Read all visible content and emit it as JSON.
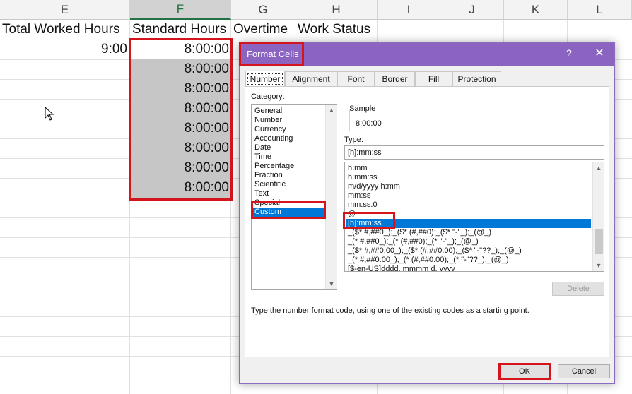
{
  "sheet": {
    "columns": [
      "E",
      "F",
      "G",
      "H",
      "I",
      "J",
      "K",
      "L"
    ],
    "headers": {
      "e": "Total Worked Hours",
      "f": "Standard Hours",
      "g": "Overtime",
      "h": "Work Status"
    },
    "total_worked_e": "9:00",
    "standard_hours": [
      "8:00:00",
      "8:00:00",
      "8:00:00",
      "8:00:00",
      "8:00:00",
      "8:00:00",
      "8:00:00",
      "8:00:00"
    ]
  },
  "dialog": {
    "title": "Format Cells",
    "help": "?",
    "close": "✕",
    "tabs": [
      "Number",
      "Alignment",
      "Font",
      "Border",
      "Fill",
      "Protection"
    ],
    "category_label": "Category:",
    "categories": [
      "General",
      "Number",
      "Currency",
      "Accounting",
      "Date",
      "Time",
      "Percentage",
      "Fraction",
      "Scientific",
      "Text",
      "Special",
      "Custom"
    ],
    "selected_category": "Custom",
    "sample_label": "Sample",
    "sample_value": "8:00:00",
    "type_label": "Type:",
    "type_value": "[h]:mm:ss",
    "type_list": [
      "h:mm",
      "h:mm:ss",
      "m/d/yyyy h:mm",
      "mm:ss",
      "mm:ss.0",
      "@",
      "[h]:mm:ss",
      "_($* #,##0_);_($* (#,##0);_($* \"-\"_);_(@_)",
      "_(* #,##0_);_(* (#,##0);_(* \"-\"_);_(@_)",
      "_($* #,##0.00_);_($* (#,##0.00);_($* \"-\"??_);_(@_)",
      "_(* #,##0.00_);_(* (#,##0.00);_(* \"-\"??_);_(@_)",
      "[$-en-US]dddd, mmmm d, yyyy"
    ],
    "selected_type": "[h]:mm:ss",
    "delete_label": "Delete",
    "hint": "Type the number format code, using one of the existing codes as a starting point.",
    "ok_label": "OK",
    "cancel_label": "Cancel"
  },
  "colors": {
    "titlebar": "#8a64c0",
    "highlight_box": "#d4161c",
    "selection": "#0078d7"
  }
}
